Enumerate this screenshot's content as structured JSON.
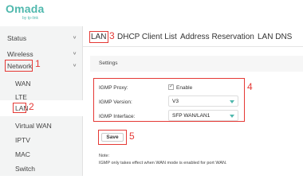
{
  "brand": {
    "name": "Omada",
    "sub": "by tp-link"
  },
  "sidebar": {
    "items": [
      {
        "label": "Status",
        "expandable": true
      },
      {
        "label": "Wireless",
        "expandable": true
      },
      {
        "label": "Network",
        "expandable": true,
        "expanded": true
      },
      {
        "label": "WAN"
      },
      {
        "label": "LTE"
      },
      {
        "label": "LAN",
        "selected": true
      },
      {
        "label": "Virtual WAN"
      },
      {
        "label": "IPTV"
      },
      {
        "label": "MAC"
      },
      {
        "label": "Switch"
      }
    ]
  },
  "tabs": [
    {
      "label": "LAN",
      "active": true
    },
    {
      "label": "DHCP Client List"
    },
    {
      "label": "Address Reservation"
    },
    {
      "label": "LAN DNS"
    }
  ],
  "settings": {
    "title": "Settings",
    "igmp_proxy_label": "IGMP Proxy:",
    "igmp_proxy_checked": true,
    "igmp_proxy_option": "Enable",
    "igmp_version_label": "IGMP Version:",
    "igmp_version_value": "V3",
    "igmp_interface_label": "IGMP Interface:",
    "igmp_interface_value": "SFP WAN/LAN1"
  },
  "save_label": "Save",
  "note": {
    "title": "Note:",
    "text": "IGMP only takes effect when WAN mode is enabled for port WAN."
  },
  "annotations": [
    "1",
    "2",
    "3",
    "4",
    "5"
  ],
  "colors": {
    "accent": "#4fb8ad",
    "annotation": "#e53935"
  }
}
